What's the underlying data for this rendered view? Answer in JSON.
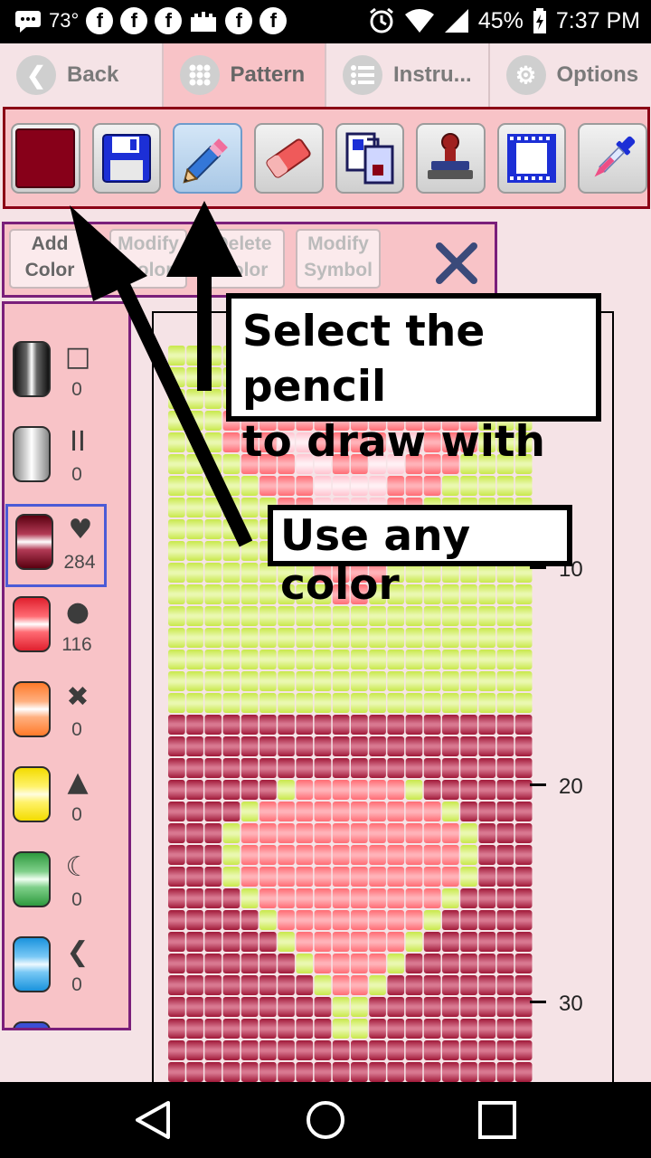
{
  "status_bar": {
    "temperature": "73°",
    "battery": "45%",
    "time": "7:37 PM",
    "icons": [
      "message-icon",
      "facebook-icon",
      "facebook-icon",
      "facebook-icon",
      "castle-icon",
      "facebook-icon",
      "facebook-icon",
      "alarm-icon",
      "wifi-icon",
      "signal-icon",
      "battery-icon"
    ]
  },
  "tabs": [
    {
      "label": "Back",
      "icon": "chevron-left-icon"
    },
    {
      "label": "Pattern",
      "icon": "grid-icon",
      "active": true
    },
    {
      "label": "Instru...",
      "icon": "list-icon"
    },
    {
      "label": "Options",
      "icon": "gear-icon"
    }
  ],
  "toolbar": {
    "current_color": "#870019",
    "tools": [
      "color-swatch",
      "save-icon",
      "pencil-icon",
      "eraser-icon",
      "copy-paste-icon",
      "stamp-icon",
      "frame-select-icon",
      "eyedropper-icon"
    ],
    "active_tool": "pencil-icon"
  },
  "edit_buttons": [
    {
      "line1": "Add",
      "line2": "Color"
    },
    {
      "line1": "Modify",
      "line2": "Color"
    },
    {
      "line1": "Delete",
      "line2": "Color"
    },
    {
      "line1": "Modify",
      "line2": "Symbol"
    }
  ],
  "palette": [
    {
      "symbol": "□",
      "count": "0",
      "color": "#2e2e2e"
    },
    {
      "symbol": "II",
      "count": "0",
      "color": "#c4c4c4"
    },
    {
      "symbol": "♥",
      "count": "284",
      "color": "#870019",
      "selected": true
    },
    {
      "symbol": "●",
      "count": "116",
      "color": "#ef3b4a"
    },
    {
      "symbol": "✖",
      "count": "0",
      "color": "#ff8a3c"
    },
    {
      "symbol": "▲",
      "count": "0",
      "color": "#ffec2a"
    },
    {
      "symbol": "☾",
      "count": "0",
      "color": "#3fb04f"
    },
    {
      "symbol": "❮",
      "count": "0",
      "color": "#29a7ea"
    }
  ],
  "pattern": {
    "colors": {
      "background_green": "#c8e84a",
      "maroon": "#a01838",
      "red": "#ff6b73",
      "pink": "#ffc3cf"
    },
    "row_labels": [
      "10",
      "20",
      "30"
    ]
  },
  "annotations": {
    "pencil_line1": "Select the pencil",
    "pencil_line2": "to draw with",
    "color_tip": "Use any color"
  },
  "nav": [
    "back-icon",
    "home-icon",
    "recents-icon"
  ]
}
